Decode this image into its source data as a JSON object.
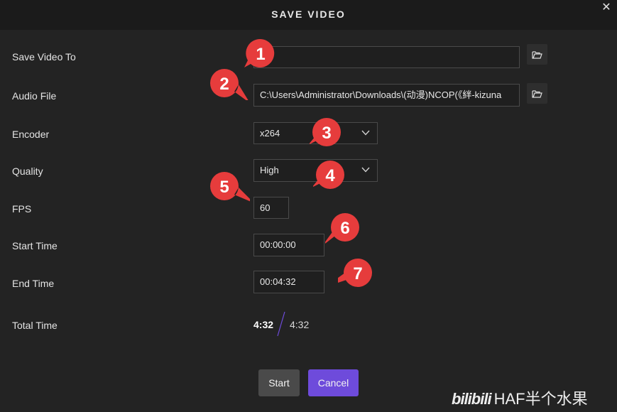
{
  "dialog": {
    "title": "SAVE VIDEO",
    "close_glyph": "✕"
  },
  "fields": {
    "save_video_to": {
      "label": "Save Video To",
      "value": ""
    },
    "audio_file": {
      "label": "Audio File",
      "value": "C:\\Users\\Administrator\\Downloads\\(动漫)NCOP(《絆-kizuna"
    },
    "encoder": {
      "label": "Encoder",
      "value": "x264"
    },
    "quality": {
      "label": "Quality",
      "value": "High"
    },
    "fps": {
      "label": "FPS",
      "value": "60"
    },
    "start_time": {
      "label": "Start Time",
      "value": "00:00:00"
    },
    "end_time": {
      "label": "End Time",
      "value": "00:04:32"
    },
    "total_time": {
      "label": "Total Time",
      "current": "4:32",
      "total": "4:32"
    }
  },
  "buttons": {
    "start": "Start",
    "cancel": "Cancel"
  },
  "annotations": [
    "1",
    "2",
    "3",
    "4",
    "5",
    "6",
    "7"
  ],
  "watermark": {
    "logo": "bilibili",
    "author": "HAF半个水果"
  },
  "icons": {
    "folder": "folder-open-icon",
    "dropdown": "chevron-down-icon",
    "close": "close-icon"
  },
  "colors": {
    "accent": "#6e4bdb",
    "marker": "#e63c3c",
    "background": "#232323",
    "header": "#1b1b1b"
  }
}
